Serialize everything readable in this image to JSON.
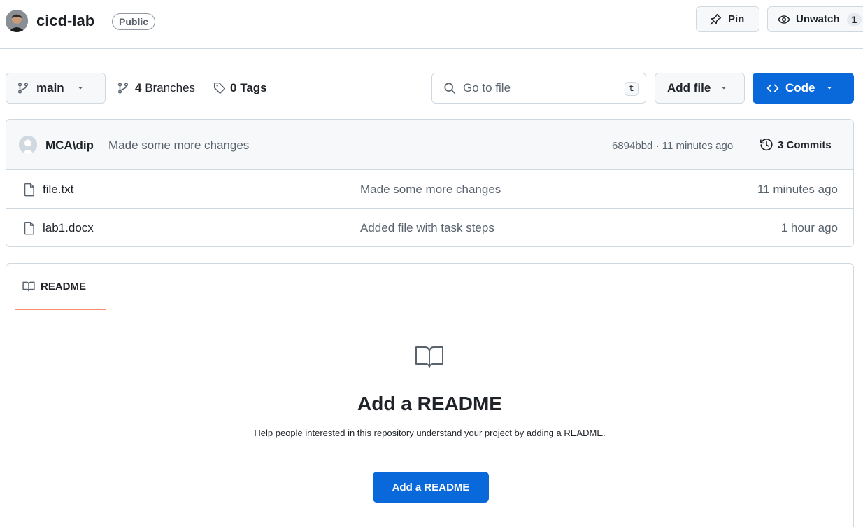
{
  "header": {
    "repo_name": "cicd-lab",
    "visibility": "Public",
    "pin_label": "Pin",
    "watch_label": "Unwatch",
    "watch_count": "1"
  },
  "toolbar": {
    "branch": "main",
    "branches_count": "4",
    "branches_label": "Branches",
    "tags_count": "0",
    "tags_label": "Tags",
    "goto_placeholder": "Go to file",
    "goto_shortcut": "t",
    "add_file_label": "Add file",
    "code_label": "Code"
  },
  "latest_commit": {
    "author": "MCA\\dip",
    "message": "Made some more changes",
    "meta": "6894bbd · 11 minutes ago",
    "commits_label": "3 Commits"
  },
  "files": [
    {
      "name": "file.txt",
      "message": "Made some more changes",
      "time": "11 minutes ago"
    },
    {
      "name": "lab1.docx",
      "message": "Added file with task steps",
      "time": "1 hour ago"
    }
  ],
  "readme": {
    "tab_label": "README",
    "title": "Add a README",
    "description": "Help people interested in this repository understand your project by adding a README.",
    "button_label": "Add a README"
  },
  "colors": {
    "primary_blue": "#0969da",
    "tab_underline": "#fd8c73",
    "border": "#d1d9e0",
    "muted_text": "#59636e"
  }
}
